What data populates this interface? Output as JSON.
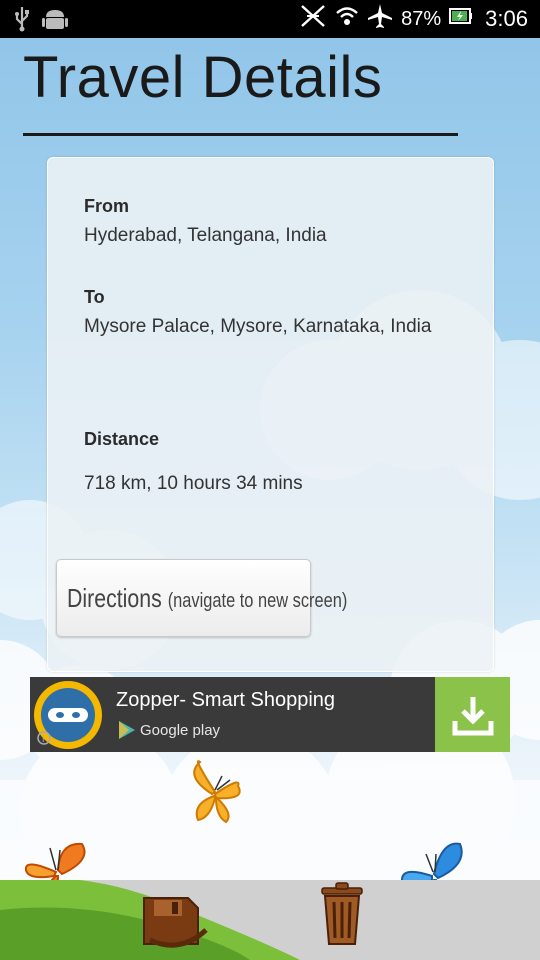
{
  "status_bar": {
    "battery": "87%",
    "time": "3:06",
    "icons": [
      "usb-icon",
      "android-icon",
      "no-sync-icon",
      "wifi-icon",
      "airplane-icon",
      "battery-icon"
    ]
  },
  "page": {
    "title": "Travel Details"
  },
  "details": {
    "from_label": "From",
    "from_value": "Hyderabad, Telangana, India",
    "to_label": "To",
    "to_value": "Mysore Palace, Mysore, Karnataka, India",
    "distance_label": "Distance",
    "distance_value": "718 km, 10 hours 34 mins"
  },
  "directions_button": {
    "label": "Directions",
    "sublabel": "(navigate to new screen)"
  },
  "ad": {
    "title": "Zopper- Smart Shopping",
    "store": "Google play",
    "accent": "#8bc34a"
  },
  "toolbar": {
    "icons": [
      "save-icon",
      "trash-icon"
    ]
  }
}
